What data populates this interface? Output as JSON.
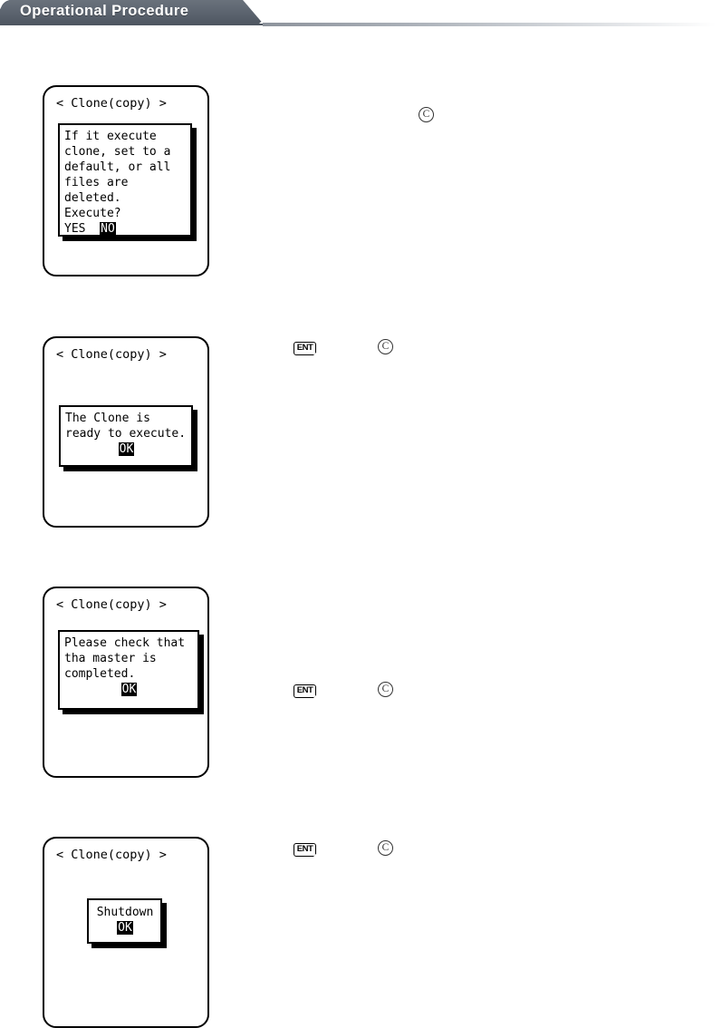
{
  "header": {
    "title": "Operational Procedure"
  },
  "panels": [
    {
      "id": "panel-clone-confirm",
      "screen_title": "< Clone(copy) >",
      "dialog": {
        "lines": [
          "If it execute",
          "clone, set to a",
          "default, or all",
          "files are",
          "deleted.",
          "Execute?"
        ],
        "choices": [
          {
            "label": "YES",
            "selected": false
          },
          {
            "label": "NO",
            "selected": true
          }
        ]
      },
      "keys": [
        {
          "type": "circled-c",
          "label": "C"
        }
      ]
    },
    {
      "id": "panel-clone-ready",
      "screen_title": "< Clone(copy) >",
      "dialog": {
        "lines": [
          "The Clone is",
          "ready to execute."
        ],
        "choices": [
          {
            "label": "OK",
            "selected": true
          }
        ]
      },
      "keys": [
        {
          "type": "ent",
          "label": "ENT"
        },
        {
          "type": "circled-c",
          "label": "C"
        }
      ]
    },
    {
      "id": "panel-check-master",
      "screen_title": "< Clone(copy) >",
      "dialog": {
        "lines": [
          "Please check that",
          "tha master is",
          "completed."
        ],
        "choices": [
          {
            "label": "OK",
            "selected": true
          }
        ]
      },
      "keys": [
        {
          "type": "ent",
          "label": "ENT"
        },
        {
          "type": "circled-c",
          "label": "C"
        }
      ]
    },
    {
      "id": "panel-shutdown",
      "screen_title": "< Clone(copy) >",
      "dialog": {
        "lines": [
          "Shutdown"
        ],
        "choices": [
          {
            "label": "OK",
            "selected": true
          }
        ]
      },
      "keys": [
        {
          "type": "ent",
          "label": "ENT"
        },
        {
          "type": "circled-c",
          "label": "C"
        }
      ]
    }
  ]
}
